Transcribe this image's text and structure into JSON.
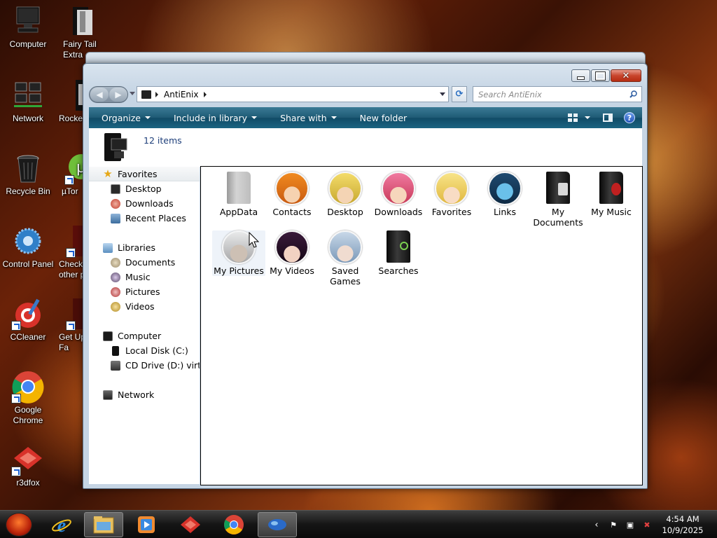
{
  "desktop": {
    "icons": [
      {
        "label": "Computer"
      },
      {
        "label": "Fairy Tail Extra"
      },
      {
        "label": "Network"
      },
      {
        "label": "Rocke"
      },
      {
        "label": "Recycle Bin"
      },
      {
        "label": "µTor"
      },
      {
        "label": "Control Panel"
      },
      {
        "label": "Check other p"
      },
      {
        "label": "CCleaner"
      },
      {
        "label": "Get Up On Fa"
      },
      {
        "label": "Google Chrome"
      },
      {
        "label": "r3dfox"
      }
    ]
  },
  "window": {
    "breadcrumb": "AntiEnix",
    "search_placeholder": "Search AntiEnix",
    "toolbar": {
      "organize": "Organize",
      "include_in_library": "Include in library",
      "share_with": "Share with",
      "new_folder": "New folder"
    },
    "details": {
      "count": "12 items"
    },
    "nav": {
      "favorites": "Favorites",
      "desktop": "Desktop",
      "downloads": "Downloads",
      "recent_places": "Recent Places",
      "libraries": "Libraries",
      "documents": "Documents",
      "music": "Music",
      "pictures": "Pictures",
      "videos": "Videos",
      "computer": "Computer",
      "local_disk": "Local Disk (C:)",
      "cd_drive": "CD Drive (D:) virtio-v",
      "network": "Network"
    },
    "items": [
      {
        "label": "AppData"
      },
      {
        "label": "Contacts"
      },
      {
        "label": "Desktop"
      },
      {
        "label": "Downloads"
      },
      {
        "label": "Favorites"
      },
      {
        "label": "Links"
      },
      {
        "label": "My Documents"
      },
      {
        "label": "My Music"
      },
      {
        "label": "My Pictures"
      },
      {
        "label": "My Videos"
      },
      {
        "label": "Saved Games"
      },
      {
        "label": "Searches"
      }
    ]
  },
  "taskbar": {
    "time": "4:54 AM",
    "date": "10/9/2025"
  },
  "colors": {
    "command_bar": "#1e5a75",
    "details_text": "#1e3f7a",
    "close_button": "#c8452c"
  }
}
